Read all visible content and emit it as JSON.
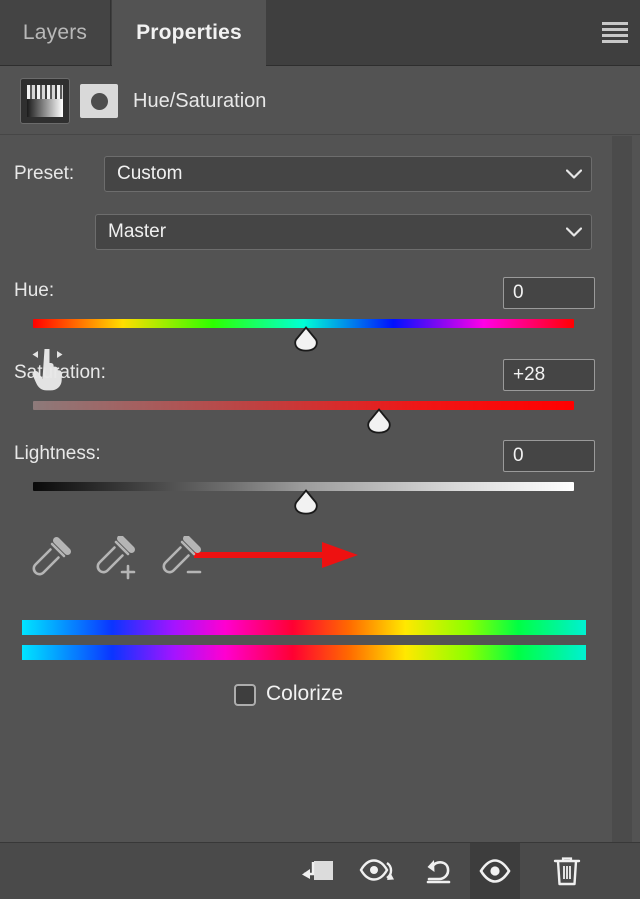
{
  "panel": {
    "tabs": [
      {
        "label": "Layers",
        "active": false
      },
      {
        "label": "Properties",
        "active": true
      }
    ],
    "menu_icon": "hamburger-menu-icon",
    "header": {
      "adjustment_icon": "hue-saturation-adjustment-icon",
      "mask_icon": "layer-mask-thumbnail-icon",
      "title": "Hue/Saturation"
    }
  },
  "preset": {
    "label": "Preset:",
    "value": "Custom",
    "chevron_icon": "chevron-down-icon"
  },
  "channel": {
    "targeted_adjustment_icon": "targeted-adjustment-hand-icon",
    "value": "Master",
    "chevron_icon": "chevron-down-icon"
  },
  "sliders": [
    {
      "name": "hue",
      "label": "Hue:",
      "value": "0",
      "handle_icon": "slider-handle"
    },
    {
      "name": "saturation",
      "label": "Saturation:",
      "value": "+28",
      "handle_icon": "slider-handle"
    },
    {
      "name": "lightness",
      "label": "Lightness:",
      "value": "0",
      "handle_icon": "slider-handle"
    }
  ],
  "eyedroppers": [
    {
      "name": "sample-color",
      "icon": "eyedropper-icon"
    },
    {
      "name": "add-to-sample",
      "icon": "eyedropper-plus-icon"
    },
    {
      "name": "subtract-from-sample",
      "icon": "eyedropper-minus-icon"
    }
  ],
  "colorize": {
    "label": "Colorize",
    "checked": false
  },
  "color_range_bars": [
    {
      "name": "source-color-range"
    },
    {
      "name": "adjusted-color-range"
    }
  ],
  "toolbar": [
    {
      "name": "clip-to-layer",
      "icon": "clip-to-layer-icon",
      "active": false
    },
    {
      "name": "view-previous-state",
      "icon": "eye-previous-state-icon",
      "active": false
    },
    {
      "name": "reset-adjustment",
      "icon": "reset-arrow-icon",
      "active": false
    },
    {
      "name": "toggle-layer-visibility",
      "icon": "eye-icon",
      "active": true
    },
    {
      "name": "delete-adjustment-layer",
      "icon": "trash-icon",
      "active": false
    }
  ],
  "annotation": {
    "name": "red-arrow-annotation",
    "color": "#ee1111",
    "points_to": "saturation-slider-handle"
  },
  "colors": {
    "panel_bg": "#535353",
    "tabbar_bg": "#3f3f3f",
    "tab_inactive_bg": "#444444",
    "toolbar_bg": "#4a4a4a",
    "field_bg": "#454545",
    "text": "#f0f0f0",
    "annotation_red": "#ee1111"
  }
}
